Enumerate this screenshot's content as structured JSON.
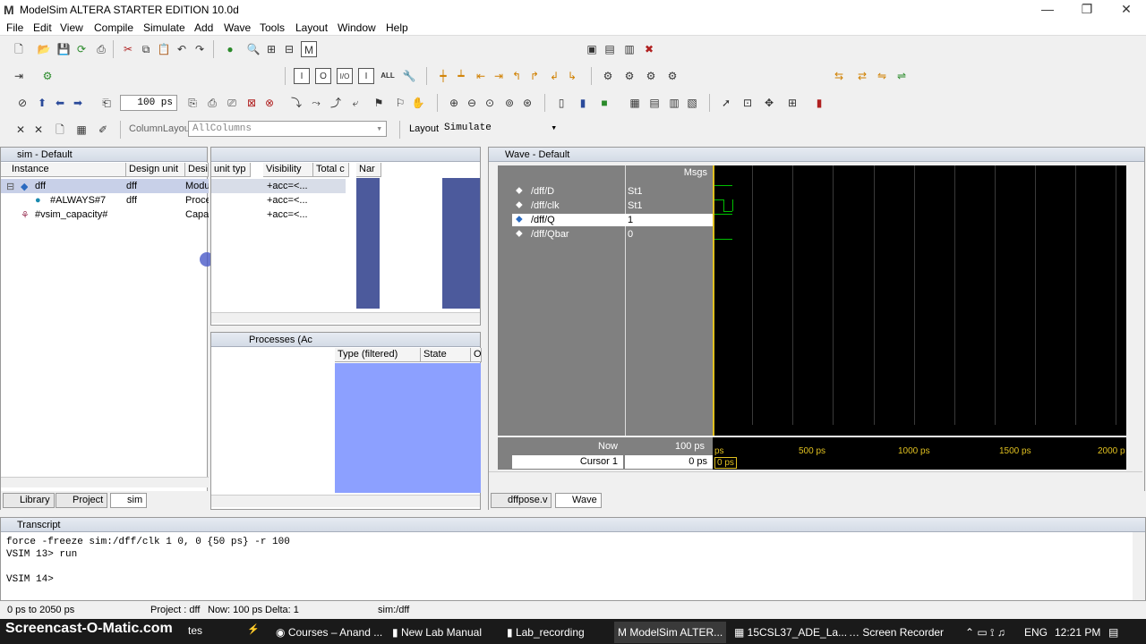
{
  "window": {
    "title": "ModelSim ALTERA STARTER EDITION 10.0d",
    "logo": "M"
  },
  "menu": [
    "File",
    "Edit",
    "View",
    "Compile",
    "Simulate",
    "Add",
    "Wave",
    "Tools",
    "Layout",
    "Window",
    "Help"
  ],
  "toolbar": {
    "zoom_value": "100 ps",
    "column_layout_label": "ColumnLayout",
    "column_layout_value": "AllColumns",
    "layout_label": "Layout",
    "layout_value": "Simulate"
  },
  "sim_pane": {
    "title": "sim - Default",
    "columns": [
      "Instance",
      "Design unit",
      "Desi"
    ],
    "rows": [
      {
        "instance": "dff",
        "unit": "dff",
        "type": "Modu"
      },
      {
        "instance": "#ALWAYS#7",
        "unit": "dff",
        "type": "Proce"
      },
      {
        "instance": "#vsim_capacity#",
        "unit": "",
        "type": "Capac"
      }
    ],
    "tabs": [
      "Library",
      "Project",
      "sim"
    ]
  },
  "objects_pane": {
    "columns": [
      "unit typ",
      "Visibility",
      "Total c",
      "Nar"
    ],
    "rows": [
      "+acc=<...",
      "+acc=<...",
      "+acc=<..."
    ]
  },
  "processes_pane": {
    "title": "Processes (Ac",
    "columns": [
      "Type (filtered)",
      "State",
      "O"
    ]
  },
  "wave": {
    "title": "Wave - Default",
    "msgs_label": "Msgs",
    "signals": [
      {
        "name": "/dff/D",
        "value": "St1"
      },
      {
        "name": "/dff/clk",
        "value": "St1"
      },
      {
        "name": "/dff/Q",
        "value": "1"
      },
      {
        "name": "/dff/Qbar",
        "value": "0"
      }
    ],
    "now_label": "Now",
    "now_value": "100 ps",
    "cursor_label": "Cursor 1",
    "cursor_value": "0 ps",
    "cursor_time": "0 ps",
    "ticks": [
      "ps",
      "500 ps",
      "1000 ps",
      "1500 ps",
      "2000 p"
    ],
    "tabs": [
      "dffpose.v",
      "Wave"
    ]
  },
  "transcript": {
    "title": "Transcript",
    "lines": [
      "force -freeze sim:/dff/clk 1 0, 0 {50 ps} -r 100",
      "VSIM 13> run",
      "",
      "VSIM 14>"
    ]
  },
  "statusbar": {
    "range": "0 ps to 2050 ps",
    "project": "Project : dff",
    "now": "Now: 100 ps",
    "delta": "Delta: 1",
    "context": "sim:/dff"
  },
  "taskbar": {
    "watermark": "Screencast-O-Matic.com",
    "watermark_suffix": "tes",
    "items": [
      "Courses – Anand ...",
      "New Lab Manual",
      "Lab_recording",
      "ModelSim ALTER...",
      "15CSL37_ADE_La...",
      "Screen Recorder"
    ],
    "lang": "ENG",
    "clock": "12:21 PM"
  },
  "colors": {
    "wave_bg": "#000000",
    "signal_green": "#00c000",
    "cursor_yellow": "#e0c020",
    "pane_blue": "#4c5a9c",
    "process_blue": "#8ca0ff"
  }
}
